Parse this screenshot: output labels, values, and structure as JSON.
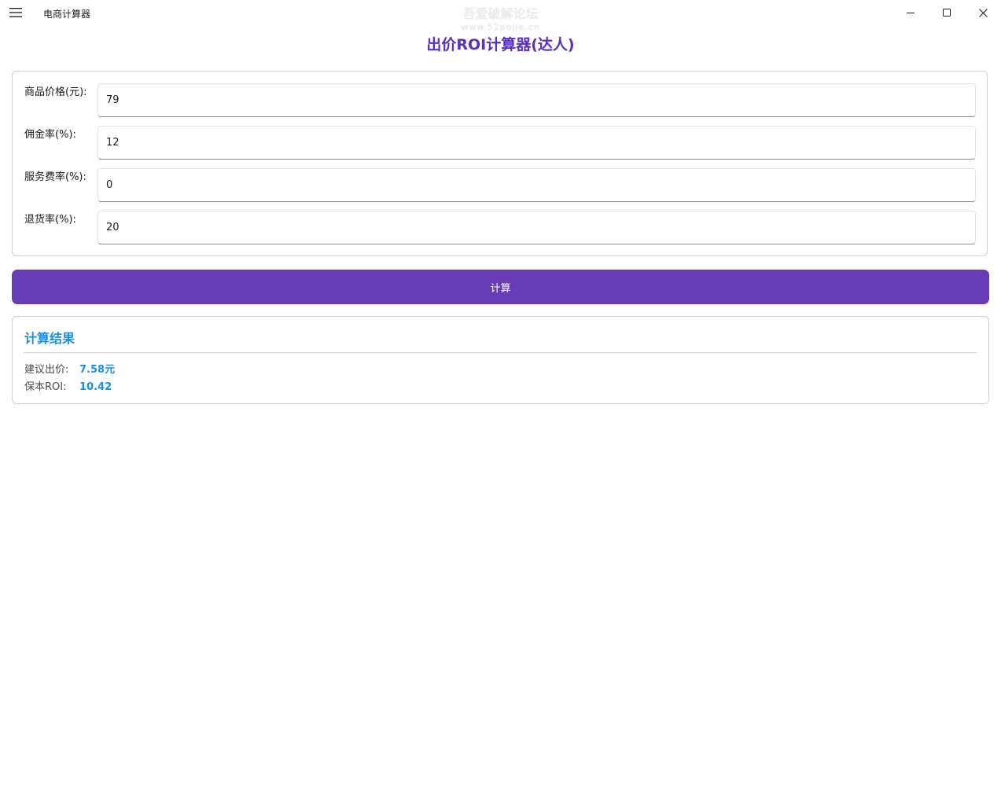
{
  "window": {
    "app_title": "电商计算器",
    "watermark_line1": "吾爱破解论坛",
    "watermark_line2": "www.52pojie.cn",
    "menu_icon": "hamburger-menu-icon",
    "minimize_icon": "minimize-icon",
    "maximize_icon": "maximize-icon",
    "close_icon": "close-icon"
  },
  "page": {
    "title": "出价ROI计算器(达人)",
    "accent_color": "#5a2fc2"
  },
  "form": {
    "fields": [
      {
        "label": "商品价格(元):",
        "value": "79"
      },
      {
        "label": "佣金率(%):",
        "value": "12"
      },
      {
        "label": "服务费率(%):",
        "value": "0"
      },
      {
        "label": "退货率(%):",
        "value": "20"
      }
    ]
  },
  "calculate_button": {
    "label": "计算",
    "color": "#683bb7"
  },
  "result": {
    "title": "计算结果",
    "title_color": "#1b8fe0",
    "rows": [
      {
        "label": "建议出价:",
        "value": "7.58元"
      },
      {
        "label": "保本ROI:",
        "value": "10.42"
      }
    ]
  }
}
